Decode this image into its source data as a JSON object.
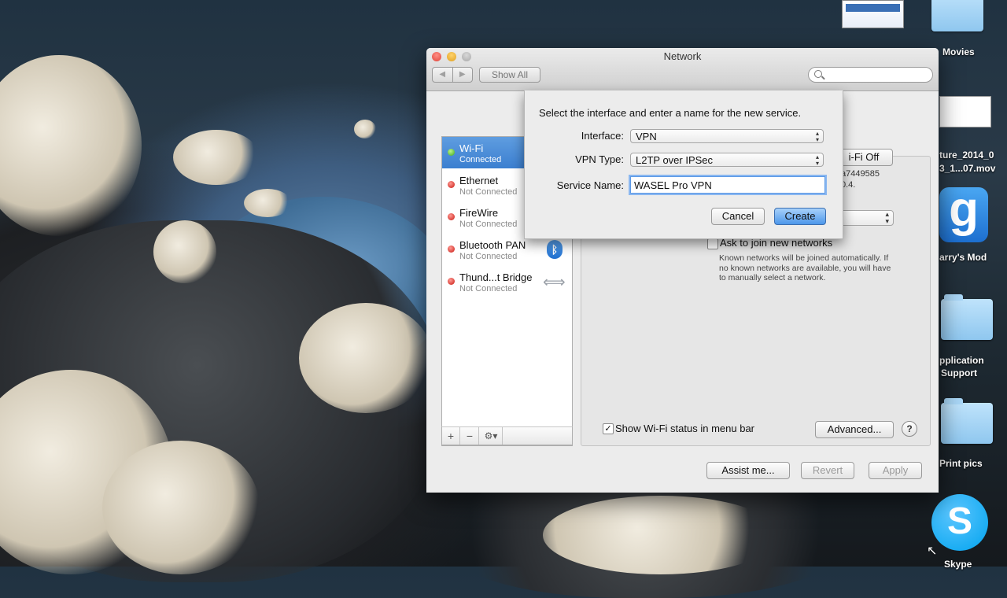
{
  "window": {
    "title": "Network",
    "nav_back": "◀",
    "nav_forward": "▶",
    "show_all": "Show All",
    "search_placeholder": ""
  },
  "services": [
    {
      "name": "Wi-Fi",
      "status": "Connected",
      "state": "connected",
      "selected": true
    },
    {
      "name": "Ethernet",
      "status": "Not Connected",
      "state": "disconnected"
    },
    {
      "name": "FireWire",
      "status": "Not Connected",
      "state": "disconnected"
    },
    {
      "name": "Bluetooth PAN",
      "status": "Not Connected",
      "state": "disconnected",
      "icon": "bluetooth-icon"
    },
    {
      "name": "Thund...t Bridge",
      "status": "Not Connected",
      "state": "disconnected",
      "icon": "thunderbolt-bridge-icon"
    }
  ],
  "list_bar": {
    "add": "+",
    "remove": "−",
    "action": "⚙▾"
  },
  "detail": {
    "wifi_button": "i-Fi Off",
    "info_line1": "a7449585",
    "info_line2": "0.4.",
    "ask_join_label": "Ask to join new networks",
    "ask_join_checked": false,
    "ask_join_note": "Known networks will be joined automatically. If no known networks are available, you will have to manually select a network.",
    "show_status_label": "Show Wi-Fi status in menu bar",
    "show_status_checked": true,
    "advanced_button": "Advanced...",
    "help_button": "?"
  },
  "footer": {
    "assist_button": "Assist me...",
    "revert_button": "Revert",
    "apply_button": "Apply"
  },
  "sheet": {
    "prompt": "Select the interface and enter a name for the new service.",
    "interface_label": "Interface:",
    "interface_value": "VPN",
    "vpn_type_label": "VPN Type:",
    "vpn_type_value": "L2TP over IPSec",
    "service_name_label": "Service Name:",
    "service_name_value": "WASEL Pro VPN",
    "cancel_button": "Cancel",
    "create_button": "Create"
  },
  "desktop": {
    "icons": [
      {
        "label": "Movies"
      },
      {
        "label": "ture_2014_0"
      },
      {
        "label": "3_1...07.mov"
      },
      {
        "label": "arry's Mod"
      },
      {
        "label": "pplication"
      },
      {
        "label": "Support"
      },
      {
        "label": "Print pics"
      },
      {
        "label": "Skype"
      }
    ]
  },
  "colors": {
    "selection": "#3b7fd0",
    "status_connected": "#3fa81e",
    "status_disconnected": "#c8170f",
    "default_button": "#4d97ea"
  }
}
